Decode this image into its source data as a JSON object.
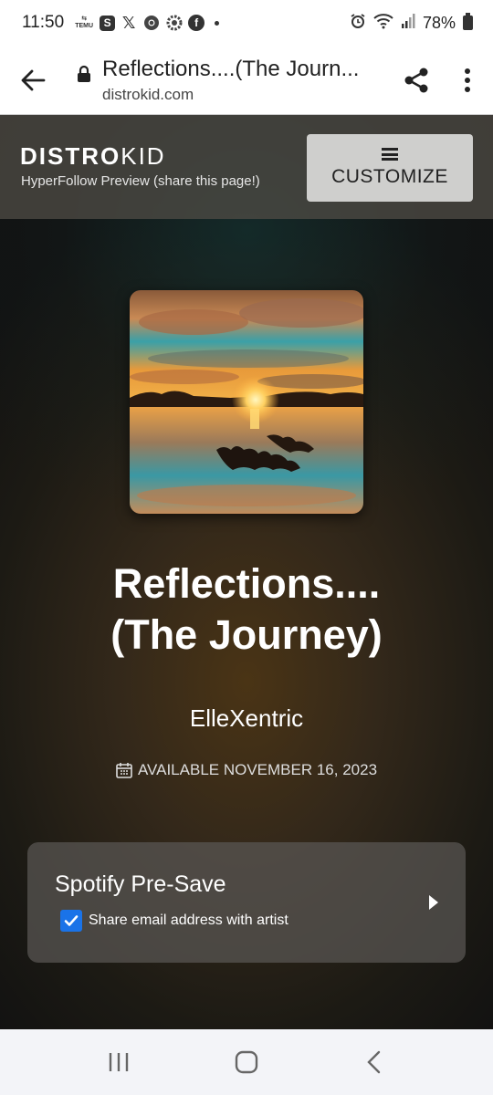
{
  "status_bar": {
    "time": "11:50",
    "temu_label": "TEMU",
    "battery": "78%",
    "icons": [
      "temu-icon",
      "s-app-icon",
      "x-icon",
      "chrome-icon",
      "settings-icon",
      "facebook-icon",
      "dot-icon",
      "alarm-icon",
      "wifi-icon",
      "signal-icon",
      "battery-icon"
    ]
  },
  "browser": {
    "page_title": "Reflections....(The Journ...",
    "url": "distrokid.com"
  },
  "header": {
    "logo_bold": "DISTRO",
    "logo_light": "KID",
    "subtitle": "HyperFollow Preview (share this page!)",
    "customize_label": "CUSTOMIZE"
  },
  "release": {
    "title_line1": "Reflections....",
    "title_line2": "(The Journey)",
    "artist": "ElleXentric",
    "available": "AVAILABLE NOVEMBER 16, 2023"
  },
  "presave": {
    "label": "Spotify Pre-Save",
    "checkbox_label": "Share email address with artist",
    "checked": true
  },
  "colors": {
    "accent": "#1a73e8",
    "button_bg": "#cfcfcd"
  }
}
